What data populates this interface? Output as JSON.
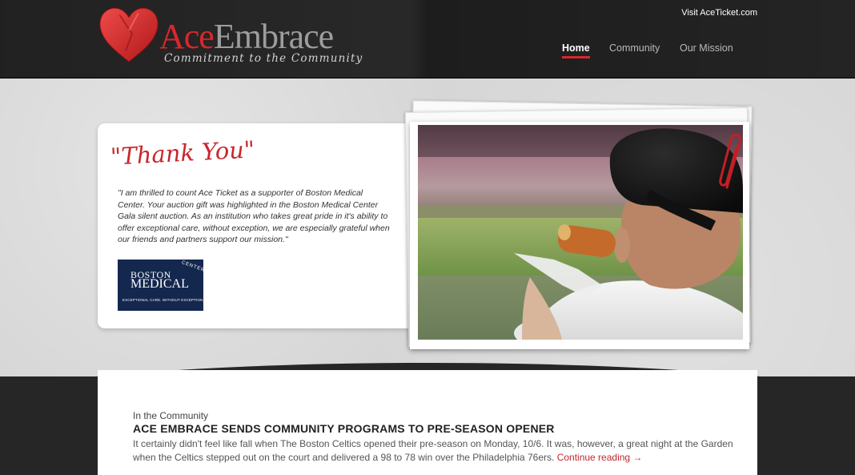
{
  "header": {
    "logo_ace": "Ace",
    "logo_embrace": "Embrace",
    "logo_tagline": "Commitment to the Community",
    "top_link": "Visit AceTicket.com"
  },
  "nav": {
    "items": [
      {
        "label": "Home",
        "active": true
      },
      {
        "label": "Community",
        "active": false
      },
      {
        "label": "Our Mission",
        "active": false
      }
    ]
  },
  "hero": {
    "heading": "\"Thank You\"",
    "quote": "\"I am thrilled to count Ace Ticket as a supporter of Boston Medical Center. Your auction gift was highlighted in the Boston Medical Center Gala silent auction. As an institution who takes great pride in it's ability to offer exceptional care, without exception, we are especially grateful when our friends and partners support our mission.\"",
    "partner_logo": {
      "line1": "BOSTON",
      "line2": "MEDICAL",
      "line3": "CENTER",
      "tagline": "EXCEPTIONAL CARE. WITHOUT EXCEPTION."
    }
  },
  "post": {
    "category": "In the Community",
    "title": "ACE EMBRACE SENDS COMMUNITY PROGRAMS TO PRE-SEASON OPENER",
    "excerpt": "It certainly didn't feel like fall when The Boston Celtics opened their pre-season on Monday, 10/6. It was, however, a great night at the Garden when the Celtics stepped out on the court and delivered a 98 to 78 win over the Philadelphia 76ers.",
    "more_link": "Continue reading →"
  },
  "colors": {
    "accent": "#d7282c",
    "header_bg": "#1d1d1d",
    "hero_bg": "#d6d6d6",
    "partner_bg": "#14274e"
  }
}
